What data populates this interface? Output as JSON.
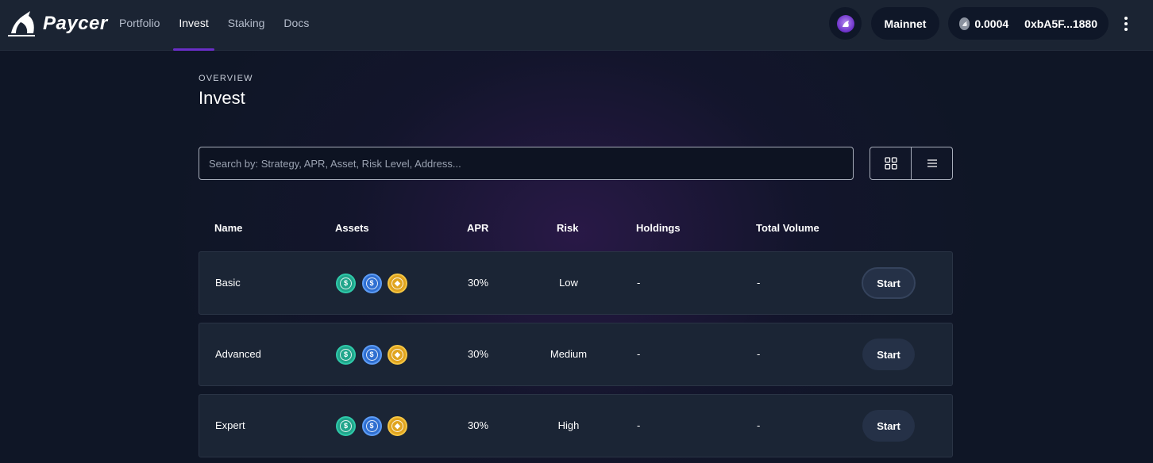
{
  "header": {
    "brand": "Paycer",
    "nav": [
      {
        "label": "Portfolio",
        "active": false
      },
      {
        "label": "Invest",
        "active": true
      },
      {
        "label": "Staking",
        "active": false
      },
      {
        "label": "Docs",
        "active": false
      }
    ],
    "network": "Mainnet",
    "balance": "0.0004",
    "address": "0xbA5F...1880",
    "icons": [
      "paycer-logo-icon",
      "profile-avatar-icon",
      "coin-icon",
      "more-vertical-icon"
    ]
  },
  "page": {
    "eyebrow": "OVERVIEW",
    "title": "Invest",
    "search_placeholder": "Search by: Strategy, APR, Asset, Risk Level, Address...",
    "view_icons": [
      "grid-view-icon",
      "list-view-icon"
    ]
  },
  "table": {
    "headers": {
      "name": "Name",
      "assets": "Assets",
      "apr": "APR",
      "risk": "Risk",
      "holdings": "Holdings",
      "volume": "Total Volume"
    },
    "rows": [
      {
        "name": "Basic",
        "apr": "30%",
        "risk": "Low",
        "holdings": "-",
        "volume": "-",
        "action": "Start"
      },
      {
        "name": "Advanced",
        "apr": "30%",
        "risk": "Medium",
        "holdings": "-",
        "volume": "-",
        "action": "Start"
      },
      {
        "name": "Expert",
        "apr": "30%",
        "risk": "High",
        "holdings": "-",
        "volume": "-",
        "action": "Start"
      }
    ],
    "asset_icons": [
      "usdc-icon",
      "usdc-blue-icon",
      "busd-icon"
    ]
  },
  "colors": {
    "background": "#0f1626",
    "header": "#1b2433",
    "accent": "#6a2ec8",
    "row": "#1b2535",
    "button": "#253147"
  }
}
